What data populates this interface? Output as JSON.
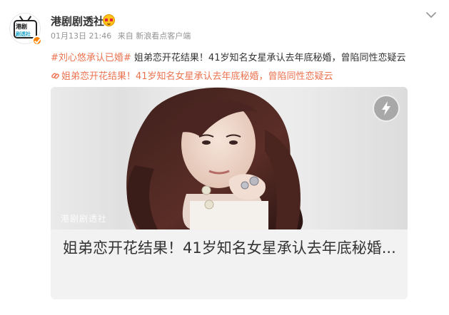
{
  "author": {
    "name": "港剧剧透社",
    "avatar_text_top": "港剧",
    "avatar_text_bottom": "剧透社",
    "badge_icon": "orange-verified-icon",
    "emoji_icon": "heart-eyes-emoji-icon"
  },
  "meta": {
    "date": "01月13日 21:46",
    "source": "来自 新浪看点客户端"
  },
  "post": {
    "hashtag": "#刘心悠承认已婚#",
    "body": " 姐弟恋开花结果！41岁知名女星承认去年底秘婚，曾陷同性恋疑云",
    "link_text": "姐弟恋开花结果！41岁知名女星承认去年底秘婚，曾陷同性恋疑云",
    "link_icon": "link-icon"
  },
  "card": {
    "watermark": "港剧剧透社",
    "title": "姐弟恋开花结果！41岁知名女星承认去年底秘婚...",
    "badge_icon": "lightning-icon"
  },
  "colors": {
    "accent": "#eb7350",
    "meta": "#939393",
    "text": "#333333"
  }
}
